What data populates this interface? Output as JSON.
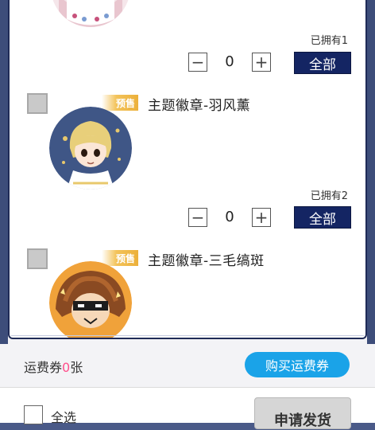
{
  "items": [
    {
      "owned_label": "已拥有1",
      "quantity": "0",
      "minus_symbol": "−",
      "plus_symbol": "+",
      "all_label": "全部"
    },
    {
      "presale_label": "预售",
      "title": "主题徽章-羽风薰",
      "owned_label": "已拥有2",
      "quantity": "0",
      "minus_symbol": "−",
      "plus_symbol": "+",
      "all_label": "全部"
    },
    {
      "presale_label": "预售",
      "title": "主题徽章-三毛缟斑"
    }
  ],
  "ticket": {
    "prefix": "运费券",
    "count": "0",
    "suffix": "张",
    "buy_label": "购买运费券"
  },
  "footer": {
    "select_all_label": "全选",
    "apply_label": "申请发货"
  },
  "colors": {
    "accent_dark": "#142563",
    "buy_blue": "#1aa3e8",
    "count_pink": "#ff4f8b",
    "presale_gold": "#ecb03a"
  }
}
